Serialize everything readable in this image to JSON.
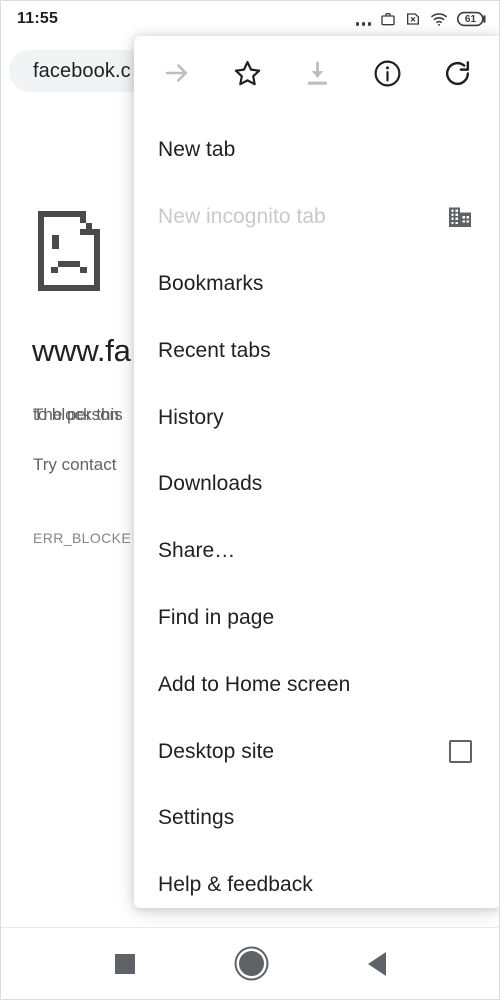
{
  "status_bar": {
    "time": "11:55",
    "icons": [
      {
        "name": "more-dots-icon"
      },
      {
        "name": "work-profile-briefcase-icon"
      },
      {
        "name": "sim-card-missing-icon"
      },
      {
        "name": "wifi-icon"
      }
    ],
    "battery_level": "61"
  },
  "toolbar": {
    "url_text": "facebook.c"
  },
  "page": {
    "icon": "sad-document-icon",
    "title": "www.fa",
    "body_lines": [
      "The person",
      "to block this",
      "Try contact"
    ],
    "error_code": "ERR_BLOCKE"
  },
  "menu": {
    "icon_row": [
      {
        "name": "forward-arrow-icon",
        "label": "Forward",
        "disabled": true
      },
      {
        "name": "bookmark-star-icon",
        "label": "Bookmark",
        "disabled": false
      },
      {
        "name": "download-icon",
        "label": "Download",
        "disabled": true
      },
      {
        "name": "page-info-icon",
        "label": "Page info",
        "disabled": false
      },
      {
        "name": "reload-icon",
        "label": "Reload",
        "disabled": false
      }
    ],
    "items": [
      {
        "label": "New tab",
        "disabled": false,
        "trailing": "none"
      },
      {
        "label": "New incognito tab",
        "disabled": true,
        "trailing": "enterprise-building-icon"
      },
      {
        "label": "Bookmarks",
        "disabled": false,
        "trailing": "none"
      },
      {
        "label": "Recent tabs",
        "disabled": false,
        "trailing": "none"
      },
      {
        "label": "History",
        "disabled": false,
        "trailing": "none"
      },
      {
        "label": "Downloads",
        "disabled": false,
        "trailing": "none"
      },
      {
        "label": "Share…",
        "disabled": false,
        "trailing": "none"
      },
      {
        "label": "Find in page",
        "disabled": false,
        "trailing": "none"
      },
      {
        "label": "Add to Home screen",
        "disabled": false,
        "trailing": "none"
      },
      {
        "label": "Desktop site",
        "disabled": false,
        "trailing": "checkbox-unchecked"
      },
      {
        "label": "Settings",
        "disabled": false,
        "trailing": "none"
      },
      {
        "label": "Help & feedback",
        "disabled": false,
        "trailing": "none"
      }
    ]
  },
  "nav_bar": {
    "buttons": [
      {
        "name": "recents-button",
        "label": "Recents"
      },
      {
        "name": "home-button",
        "label": "Home"
      },
      {
        "name": "back-button",
        "label": "Back"
      }
    ]
  },
  "colors": {
    "text_primary": "#202124",
    "text_secondary": "#5f6368",
    "text_disabled": "#c8c9ca",
    "omnibox_bg": "#f1f3f4",
    "panel_bg": "#ffffff"
  }
}
